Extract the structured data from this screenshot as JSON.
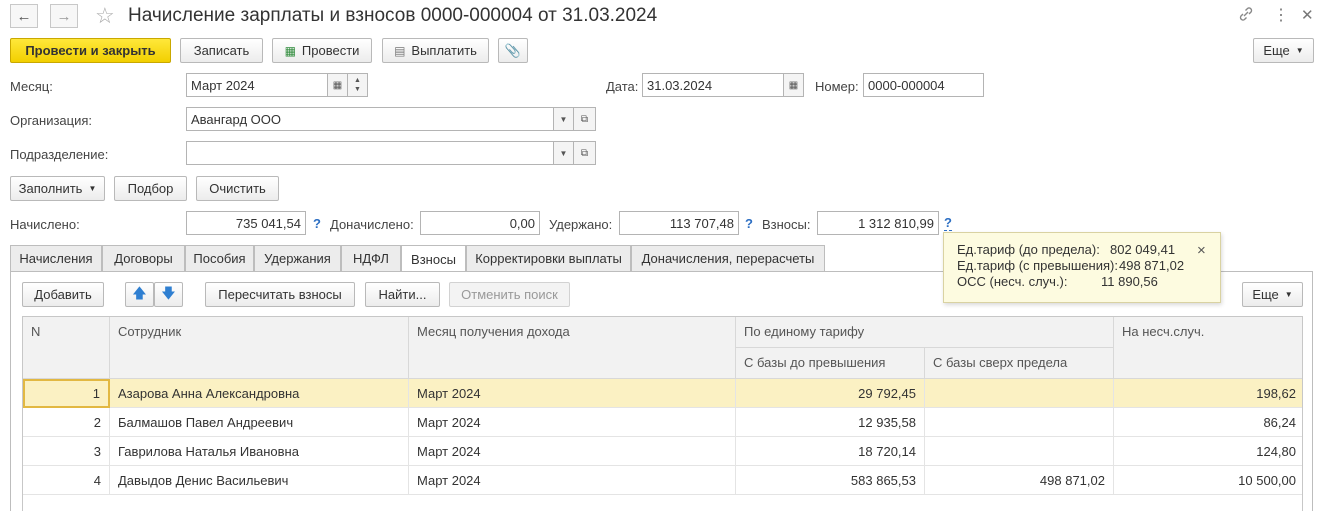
{
  "window": {
    "title": "Начисление зарплаты и взносов 0000-000004 от 31.03.2024",
    "back_icon": "arrow-left-icon",
    "forward_icon": "arrow-right-icon",
    "star_icon": "star-icon",
    "link_icon": "link-icon",
    "menu_icon": "more-vertical-icon",
    "close_icon": "close-icon"
  },
  "toolbar": {
    "post_close": "Провести и закрыть",
    "save": "Записать",
    "post": "Провести",
    "pay": "Выплатить",
    "more": "Еще"
  },
  "form": {
    "month_label": "Месяц:",
    "month_value": "Март 2024",
    "date_label": "Дата:",
    "date_value": "31.03.2024",
    "number_label": "Номер:",
    "number_value": "0000-000004",
    "org_label": "Организация:",
    "org_value": "Авангард ООО",
    "dept_label": "Подразделение:",
    "dept_value": ""
  },
  "actions": {
    "fill": "Заполнить",
    "select": "Подбор",
    "clear": "Очистить"
  },
  "totals": {
    "accrued_label": "Начислено:",
    "accrued_value": "735 041,54",
    "extra_label": "Доначислено:",
    "extra_value": "0,00",
    "withheld_label": "Удержано:",
    "withheld_value": "113 707,48",
    "contrib_label": "Взносы:",
    "contrib_value": "1 312 810,99",
    "help": "?"
  },
  "tabs": [
    "Начисления",
    "Договоры",
    "Пособия",
    "Удержания",
    "НДФЛ",
    "Взносы",
    "Корректировки выплаты",
    "Доначисления, перерасчеты"
  ],
  "active_tab": "Взносы",
  "table_toolbar": {
    "add": "Добавить",
    "recalc": "Пересчитать взносы",
    "find": "Найти...",
    "cancel_search": "Отменить поиск",
    "more": "Еще"
  },
  "tooltip": {
    "line1_label": "Ед.тариф (до предела):",
    "line1_value": "802 049,41",
    "line2_label": "Ед.тариф (с превышения):",
    "line2_value": "498 871,02",
    "line3_label": "ОСС (несч. случ.):",
    "line3_value": "11 890,56",
    "close": "×"
  },
  "table": {
    "headers": {
      "n": "N",
      "employee": "Сотрудник",
      "month": "Месяц получения дохода",
      "single_tariff": "По единому тарифу",
      "base_below": "С базы до превышения",
      "base_above": "С базы сверх предела",
      "accident": "На несч.случ."
    },
    "rows": [
      {
        "n": "1",
        "employee": "Азарова Анна Александровна",
        "month": "Март 2024",
        "below": "29 792,45",
        "above": "",
        "accident": "198,62"
      },
      {
        "n": "2",
        "employee": "Балмашов Павел Андреевич",
        "month": "Март 2024",
        "below": "12 935,58",
        "above": "",
        "accident": "86,24"
      },
      {
        "n": "3",
        "employee": "Гаврилова Наталья Ивановна",
        "month": "Март 2024",
        "below": "18 720,14",
        "above": "",
        "accident": "124,80"
      },
      {
        "n": "4",
        "employee": "Давыдов Денис Васильевич",
        "month": "Март 2024",
        "below": "583 865,53",
        "above": "498 871,02",
        "accident": "10 500,00"
      }
    ]
  }
}
